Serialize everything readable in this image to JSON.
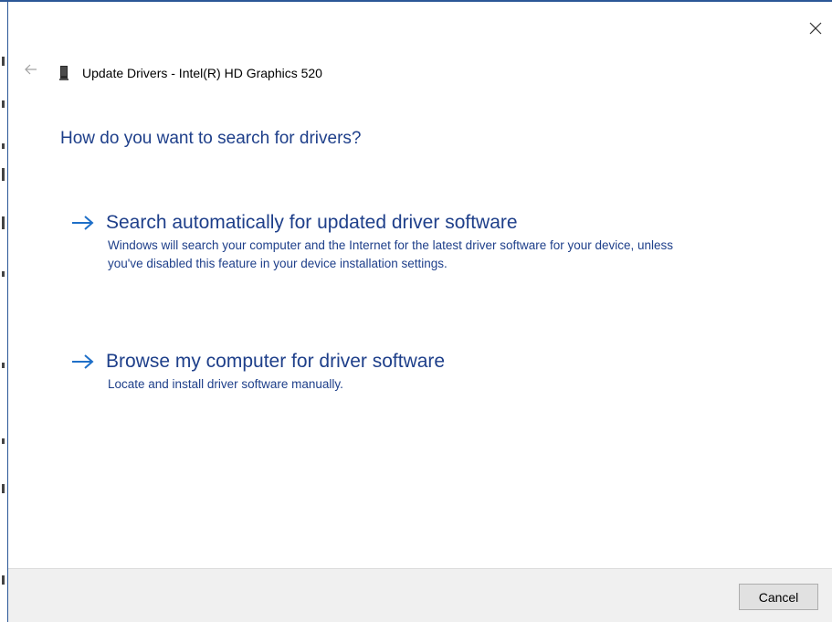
{
  "window": {
    "accent_color": "#1e3f8a",
    "close_icon": "close-icon",
    "back_icon": "back-arrow-icon"
  },
  "header": {
    "device_icon": "graphics-card-icon",
    "title": "Update Drivers - Intel(R) HD Graphics 520"
  },
  "main": {
    "question": "How do you want to search for drivers?",
    "options": [
      {
        "icon": "arrow-right-icon",
        "title": "Search automatically for updated driver software",
        "description": "Windows will search your computer and the Internet for the latest driver software for your device, unless you've disabled this feature in your device installation settings."
      },
      {
        "icon": "arrow-right-icon",
        "title": "Browse my computer for driver software",
        "description": "Locate and install driver software manually."
      }
    ]
  },
  "footer": {
    "cancel_label": "Cancel"
  }
}
